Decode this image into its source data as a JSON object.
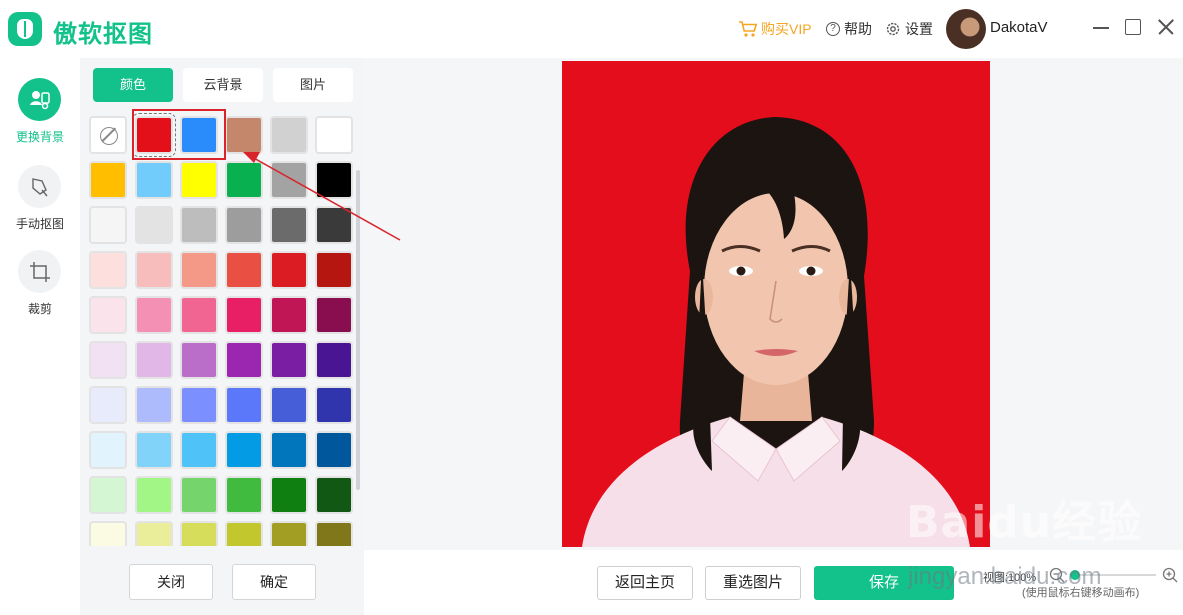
{
  "app": {
    "title": "傲软抠图",
    "brand_color": "#12c28a"
  },
  "header": {
    "vip_label": "购买VIP",
    "help_label": "帮助",
    "settings_label": "设置",
    "username": "DakotaV",
    "icons": [
      "cart-icon",
      "help-icon",
      "gear-icon",
      "minimize-icon",
      "maximize-icon",
      "close-icon"
    ]
  },
  "sidebar": {
    "items": [
      {
        "label": "更换背景",
        "icon": "swap-background-icon",
        "active": true
      },
      {
        "label": "手动抠图",
        "icon": "hand-cutout-icon",
        "active": false
      },
      {
        "label": "裁剪",
        "icon": "crop-icon",
        "active": false
      }
    ]
  },
  "panel": {
    "tabs": [
      {
        "label": "颜色",
        "active": true
      },
      {
        "label": "云背景",
        "active": false
      },
      {
        "label": "图片",
        "active": false
      }
    ],
    "swatches": [
      [
        "none",
        "#e31019",
        "#2a8bfa",
        "#c4876c",
        "#d1d1d1",
        "#ffffff"
      ],
      [
        "#ffbe00",
        "#72ccfb",
        "#ffff00",
        "#09b050",
        "#a3a3a3",
        "#000000"
      ],
      [
        "#f5f5f5",
        "#e3e3e3",
        "#bdbdbd",
        "#9d9d9d",
        "#6b6b6b",
        "#3a3a3a"
      ],
      [
        "#fde0dd",
        "#f7bcbc",
        "#f49887",
        "#e94f42",
        "#dc1c23",
        "#b5160f"
      ],
      [
        "#fbe3ec",
        "#f390b4",
        "#f06591",
        "#e81f64",
        "#c01656",
        "#880e4f"
      ],
      [
        "#f2e0f3",
        "#e0b7e6",
        "#bb6dca",
        "#9b27b0",
        "#7a1ea3",
        "#4a1593"
      ],
      [
        "#e7ebfb",
        "#adbbfc",
        "#7b8fff",
        "#5b78fa",
        "#475ed9",
        "#3035ae"
      ],
      [
        "#e1f4fd",
        "#81d3f9",
        "#4fc3f7",
        "#049be5",
        "#0276bd",
        "#01579b"
      ],
      [
        "#d5f6d3",
        "#a2f686",
        "#75d46c",
        "#40bb3f",
        "#0f7f12",
        "#105814"
      ],
      [
        "#fbfbe3",
        "#eaed9a",
        "#d6dd5a",
        "#c2c72e",
        "#a19e23",
        "#7f7719"
      ]
    ],
    "selected_swatch": {
      "row": 0,
      "col": 1
    },
    "close_label": "关闭",
    "confirm_label": "确定"
  },
  "canvas": {
    "background_color": "#e30d1b",
    "subject": "id-photo-woman"
  },
  "footer": {
    "home_label": "返回主页",
    "reselect_label": "重选图片",
    "save_label": "保存",
    "zoom_label": "视图:100%",
    "zoom_level": 0.0,
    "hint": "(使用鼠标右键移动画布)"
  },
  "watermark": {
    "text": "Baidu经验",
    "sub": "jingyan.baidu.com"
  }
}
